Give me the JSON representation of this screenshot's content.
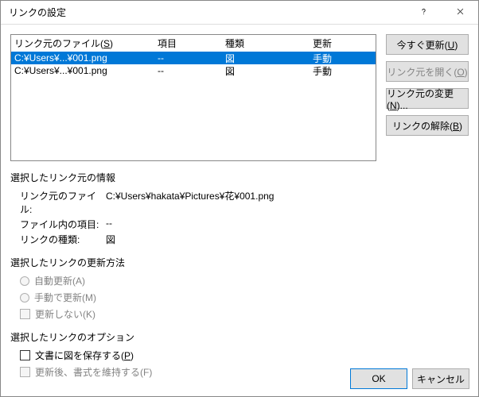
{
  "title": "リンクの設定",
  "columns": {
    "file": "リンク元のファイル(S)",
    "item": "項目",
    "type": "種類",
    "update": "更新"
  },
  "rows": [
    {
      "file": "C:¥Users¥...¥001.png",
      "item": "--",
      "type": "図",
      "update": "手動",
      "selected": true
    },
    {
      "file": "C:¥Users¥...¥001.png",
      "item": "--",
      "type": "図",
      "update": "手動",
      "selected": false
    }
  ],
  "buttons": {
    "updateNow": "今すぐ更新(U)",
    "openSource": "リンク元を開く(O)",
    "changeSource": "リンク元の変更(N)...",
    "breakLink": "リンクの解除(B)"
  },
  "info": {
    "title": "選択したリンク元の情報",
    "fileLabel": "リンク元のファイル:",
    "fileValue": "C:¥Users¥hakata¥Pictures¥花¥001.png",
    "itemLabel": "ファイル内の項目:",
    "itemValue": "--",
    "typeLabel": "リンクの種類:",
    "typeValue": "図"
  },
  "updateMethod": {
    "title": "選択したリンクの更新方法",
    "auto": "自動更新(A)",
    "manual": "手動で更新(M)",
    "locked": "更新しない(K)"
  },
  "options": {
    "title": "選択したリンクのオプション",
    "savePic": "文書に図を保存する(P)",
    "keepFormat": "更新後、書式を維持する(F)"
  },
  "footer": {
    "ok": "OK",
    "cancel": "キャンセル"
  }
}
